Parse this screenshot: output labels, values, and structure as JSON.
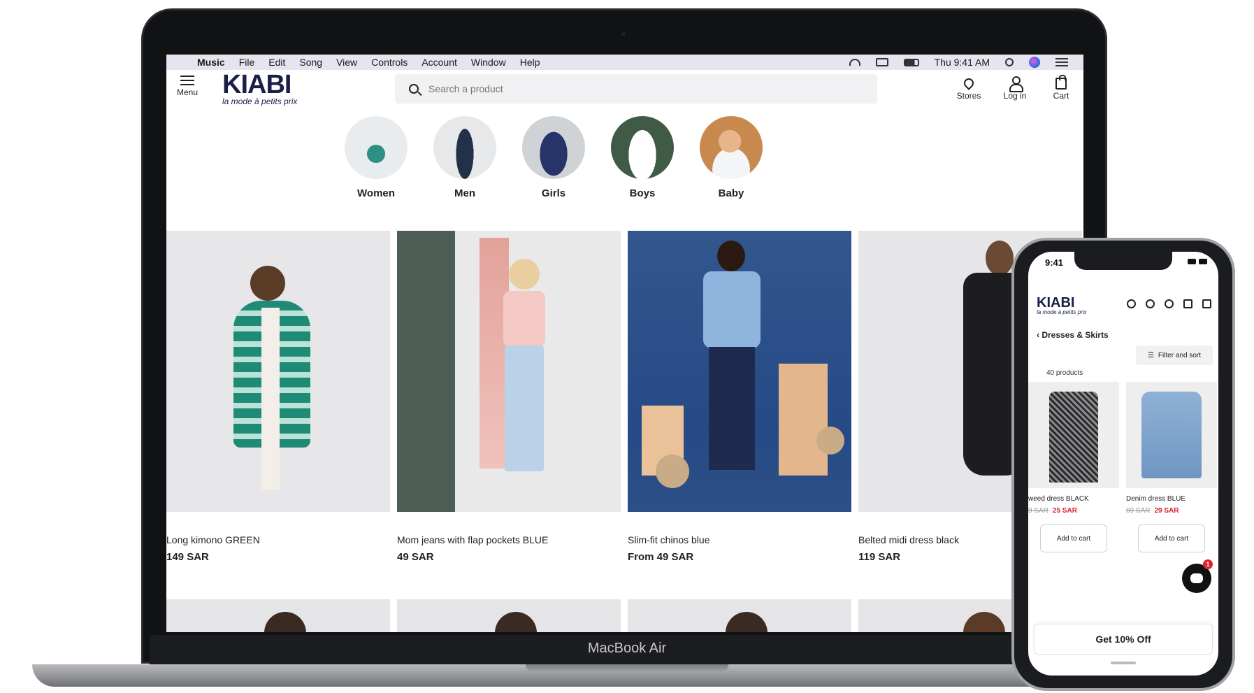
{
  "device": {
    "laptop_label": "MacBook Air"
  },
  "menubar": {
    "app": "Music",
    "items": [
      "File",
      "Edit",
      "Song",
      "View",
      "Controls",
      "Account",
      "Window",
      "Help"
    ],
    "clock": "Thu 9:41 AM"
  },
  "site": {
    "menu_label": "Menu",
    "logo": "KIABI",
    "tagline": "la mode à petits prix",
    "search": {
      "placeholder": "Search a product",
      "value": ""
    },
    "actions": {
      "stores": "Stores",
      "login": "Log in",
      "cart": "Cart"
    },
    "brand_color": "#1a1f4a"
  },
  "categories": [
    {
      "label": "Women",
      "icon": "women-avatar"
    },
    {
      "label": "Men",
      "icon": "men-avatar"
    },
    {
      "label": "Girls",
      "icon": "girls-avatar"
    },
    {
      "label": "Boys",
      "icon": "boys-avatar"
    },
    {
      "label": "Baby",
      "icon": "baby-avatar"
    }
  ],
  "products": [
    {
      "name": "Long kimono GREEN",
      "price": "149 SAR"
    },
    {
      "name": "Mom jeans with flap pockets BLUE",
      "price": "49 SAR"
    },
    {
      "name": "Slim-fit chinos blue",
      "price": "From 49 SAR"
    },
    {
      "name": "Belted midi dress black",
      "price": "119 SAR"
    }
  ],
  "phone": {
    "time": "9:41",
    "logo": "KIABI",
    "tagline": "la mode à petits prix",
    "breadcrumb": "Dresses & Skirts",
    "filter_label": "Filter and sort",
    "count": "40 products",
    "products": [
      {
        "name": "weed dress BLACK",
        "old_price": "9 SAR",
        "new_price": "25 SAR",
        "button": "Add to cart"
      },
      {
        "name": "Denim dress BLUE",
        "old_price": "69 SAR",
        "new_price": "29 SAR",
        "button": "Add to cart"
      }
    ],
    "chat_badge": "1",
    "cta": "Get 10% Off",
    "sale_color": "#d8202a"
  }
}
